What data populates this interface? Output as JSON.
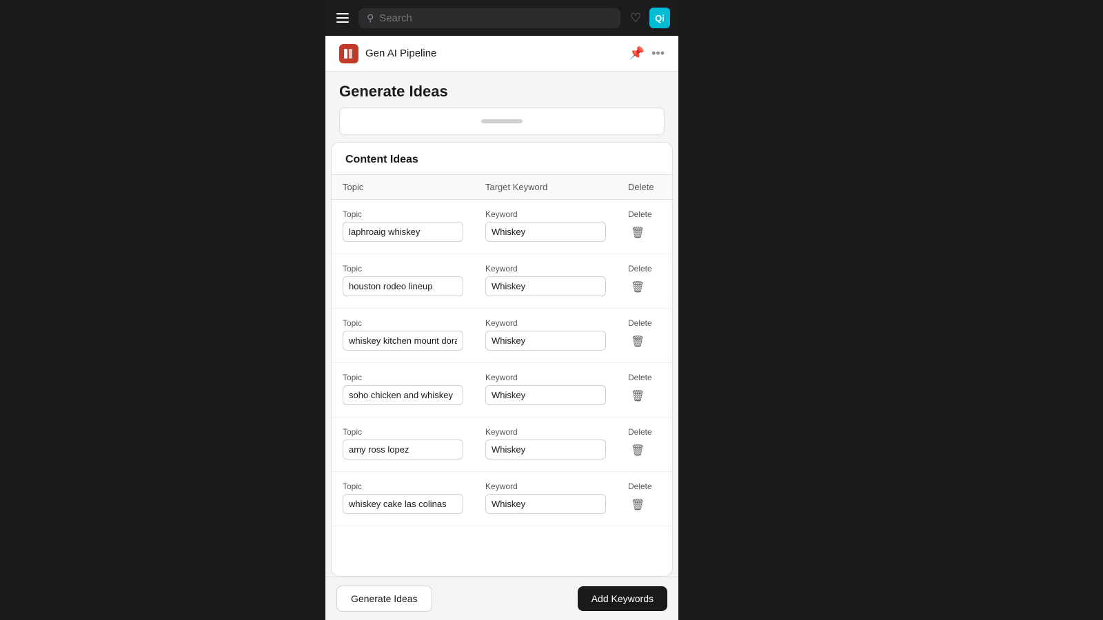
{
  "topbar": {
    "search_placeholder": "Search",
    "avatar_text": "Qi",
    "avatar_color": "#00bcd4"
  },
  "secondbar": {
    "app_name": "Gen AI Pipeline"
  },
  "page": {
    "title": "Generate Ideas"
  },
  "content_ideas": {
    "section_title": "Content Ideas",
    "table_headers": {
      "topic": "Topic",
      "keyword": "Target Keyword",
      "delete": "Delete"
    },
    "rows": [
      {
        "topic_label": "Topic",
        "topic_value": "laphroaig whiskey",
        "keyword_label": "Keyword",
        "keyword_value": "Whiskey",
        "delete_label": "Delete"
      },
      {
        "topic_label": "Topic",
        "topic_value": "houston rodeo lineup",
        "keyword_label": "Keyword",
        "keyword_value": "Whiskey",
        "delete_label": "Delete"
      },
      {
        "topic_label": "Topic",
        "topic_value": "whiskey kitchen mount dora",
        "keyword_label": "Keyword",
        "keyword_value": "Whiskey",
        "delete_label": "Delete"
      },
      {
        "topic_label": "Topic",
        "topic_value": "soho chicken and whiskey",
        "keyword_label": "Keyword",
        "keyword_value": "Whiskey",
        "delete_label": "Delete"
      },
      {
        "topic_label": "Topic",
        "topic_value": "amy ross lopez",
        "keyword_label": "Keyword",
        "keyword_value": "Whiskey",
        "delete_label": "Delete"
      },
      {
        "topic_label": "Topic",
        "topic_value": "whiskey cake las colinas",
        "keyword_label": "Keyword",
        "keyword_value": "Whiskey",
        "delete_label": "Delete"
      }
    ]
  },
  "footer": {
    "generate_label": "Generate Ideas",
    "add_keywords_label": "Add Keywords"
  }
}
